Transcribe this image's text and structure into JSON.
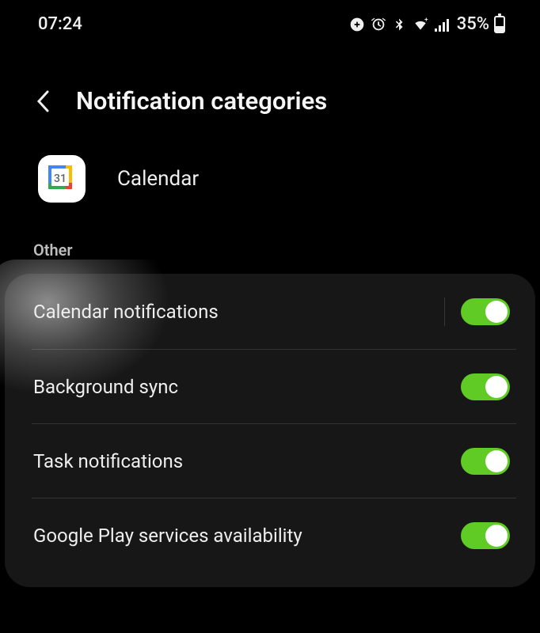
{
  "status": {
    "time": "07:24",
    "battery_percent": "35%"
  },
  "header": {
    "title": "Notification categories"
  },
  "app": {
    "name": "Calendar",
    "icon_day": "31"
  },
  "section": {
    "label": "Other"
  },
  "settings": [
    {
      "label": "Calendar notifications",
      "on": true
    },
    {
      "label": "Background sync",
      "on": true
    },
    {
      "label": "Task notifications",
      "on": true
    },
    {
      "label": "Google Play services availability",
      "on": true
    }
  ]
}
